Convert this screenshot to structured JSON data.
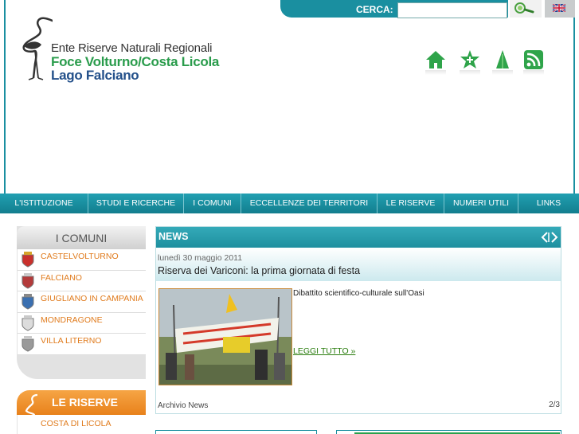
{
  "header": {
    "logo": {
      "line1": "Ente Riserve Naturali Regionali",
      "line2": "Foce Volturno/Costa Licola",
      "line3": "Lago Falciano"
    },
    "search": {
      "label": "CERCA:",
      "value": "",
      "placeholder": ""
    },
    "icons": [
      "home-icon",
      "star-icon",
      "tree-icon",
      "rss-icon"
    ],
    "language_flag": "uk-flag-icon"
  },
  "nav": {
    "items": [
      "L'ISTITUZIONE",
      "STUDI E RICERCHE",
      "I COMUNI",
      "ECCELLENZE DEI TERRITORI",
      "LE RISERVE",
      "NUMERI UTILI",
      "LINKS"
    ]
  },
  "sidebar": {
    "comuni": {
      "title": "I COMUNI",
      "items": [
        "CASTELVOLTURNO",
        "FALCIANO",
        "GIUGLIANO IN CAMPANIA",
        "MONDRAGONE",
        "VILLA LITERNO"
      ]
    },
    "riserve": {
      "title": "LE RISERVE",
      "items": [
        "COSTA DI LICOLA"
      ]
    }
  },
  "news": {
    "title": "NEWS",
    "date": "lunedì 30 maggio 2011",
    "headline": "Riserva dei Variconi: la prima giornata di festa",
    "description": "Dibattito scientifico-culturale sull'Oasi",
    "read_more": "LEGGI TUTTO »",
    "archive": "Archivio News",
    "pagination": "2/3"
  },
  "colors": {
    "teal": "#1a8fa0",
    "orange": "#e8811b",
    "green": "#2a9c4c",
    "blue": "#23508a"
  }
}
